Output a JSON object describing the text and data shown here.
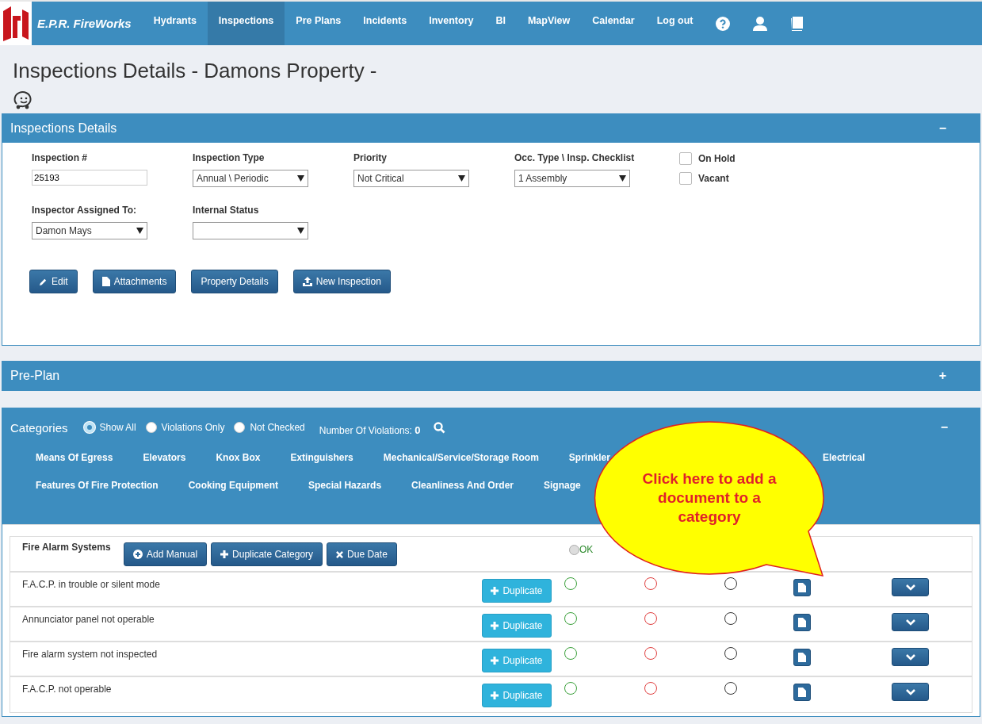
{
  "nav": {
    "brand": "E.P.R. FireWorks",
    "items": [
      {
        "label": "Hydrants",
        "selected": false
      },
      {
        "label": "Inspections",
        "selected": true
      },
      {
        "label": "Pre Plans",
        "selected": false
      },
      {
        "label": "Incidents",
        "selected": false
      },
      {
        "label": "Inventory",
        "selected": false
      },
      {
        "label": "BI",
        "selected": false
      },
      {
        "label": "MapView",
        "selected": false
      },
      {
        "label": "Calendar",
        "selected": false
      },
      {
        "label": "Log out",
        "selected": false
      }
    ]
  },
  "page_title": "Inspections Details - Damons Property -",
  "details": {
    "title": "Inspections Details",
    "toggle": "−",
    "fields": [
      {
        "label": "Inspection #",
        "kind": "text",
        "value": "25193"
      },
      {
        "label": "Inspection Type",
        "kind": "select",
        "value": "Annual \\ Periodic"
      },
      {
        "label": "Priority",
        "kind": "select",
        "value": "Not Critical"
      },
      {
        "label": "Occ. Type \\ Insp. Checklist",
        "kind": "select",
        "value": "1 Assembly"
      }
    ],
    "checkboxes": [
      {
        "label": "On Hold",
        "checked": false
      },
      {
        "label": "Vacant",
        "checked": false
      }
    ],
    "fields_2": [
      {
        "label": "Inspector Assigned To:",
        "kind": "select",
        "value": "Damon Mays"
      },
      {
        "label": "Internal Status",
        "kind": "select"
      }
    ],
    "buttons": [
      {
        "label": "Edit"
      },
      {
        "label": "Attachments"
      },
      {
        "label": "Property Details"
      },
      {
        "label": "New Inspection"
      }
    ]
  },
  "preplan": {
    "title": "Pre-Plan",
    "toggle": "+"
  },
  "categories": {
    "title": "Categories",
    "toggle": "−",
    "filters": [
      {
        "label": "Show All",
        "selected": true
      },
      {
        "label": "Violations Only",
        "selected": false
      },
      {
        "label": "Not Checked",
        "selected": false
      }
    ],
    "violations_label": "Number Of Violations:",
    "violations_count": "0",
    "tabs_row_1": [
      "Means Of Egress",
      "Elevators",
      "Knox Box",
      "Extinguishers",
      "Mechanical/Service/Storage Room",
      "Sprinkler",
      "Electrical"
    ],
    "tabs_row_2": [
      "Features Of Fire Protection",
      "Cooking Equipment",
      "Special Hazards",
      "Cleanliness And Order",
      "Signage"
    ]
  },
  "checklist": {
    "title": "Fire Alarm Systems",
    "buttons": [
      {
        "label": "Add Manual"
      },
      {
        "label": "Duplicate Category"
      },
      {
        "label": "Due Date"
      }
    ],
    "ok_selected": false,
    "ok_label": "OK",
    "items": [
      {
        "text": "F.A.C.P. in trouble or silent mode",
        "button": "Duplicate",
        "choices": [
          {
            "selected": false
          },
          {
            "selected": false
          },
          {
            "selected": false
          }
        ]
      },
      {
        "text": "Annunciator panel not operable",
        "button": "Duplicate",
        "choices": [
          {
            "selected": false
          },
          {
            "selected": false
          },
          {
            "selected": false
          }
        ]
      },
      {
        "text": "Fire alarm system not inspected",
        "button": "Duplicate",
        "choices": [
          {
            "selected": false
          },
          {
            "selected": false
          },
          {
            "selected": false
          }
        ]
      },
      {
        "text": "F.A.C.P. not operable",
        "button": "Duplicate",
        "choices": [
          {
            "selected": false
          },
          {
            "selected": false
          },
          {
            "selected": false
          }
        ]
      }
    ]
  },
  "callout": {
    "text": "Click here to add a document to a category"
  }
}
